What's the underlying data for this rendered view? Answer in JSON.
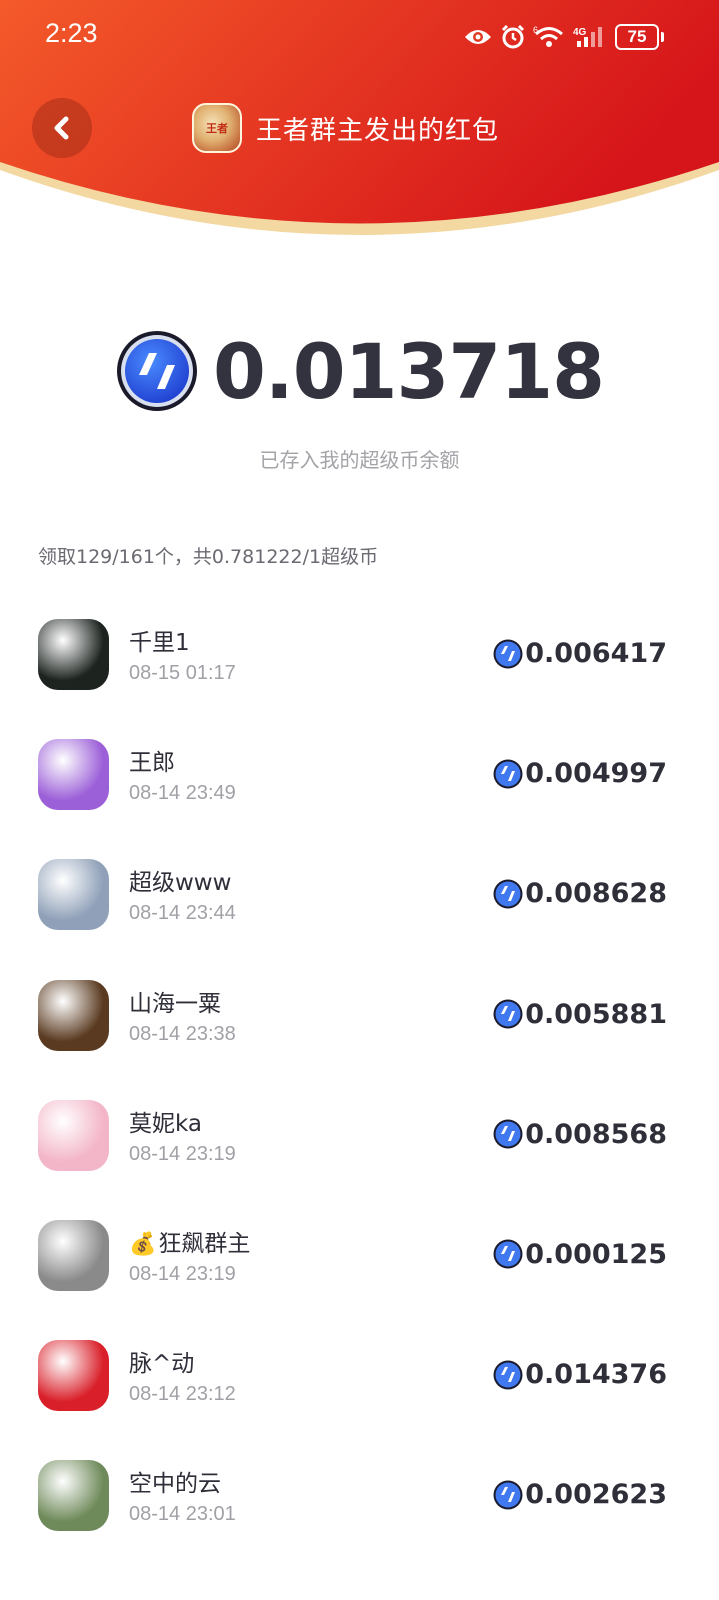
{
  "status_bar": {
    "time": "2:23",
    "network": "4G",
    "wifi_badge": "6",
    "battery": "75"
  },
  "header": {
    "title": "王者群主发出的红包",
    "back_icon": "chevron-left-icon",
    "avatar_text": "王者",
    "colors": {
      "top": "#f45a2a",
      "bottom": "#d6151a",
      "rim": "#f3d8a2"
    }
  },
  "received": {
    "amount": "0.013718",
    "subtitle": "已存入我的超级币余额"
  },
  "summary": "领取129/161个，共0.781222/1超级币",
  "claims": [
    {
      "name": "千里1",
      "time": "08-15 01:17",
      "amount": "0.006417",
      "avatar_color": "#1d2420"
    },
    {
      "name": "王郎",
      "time": "08-14 23:49",
      "amount": "0.004997",
      "avatar_color": "#9b5fd8"
    },
    {
      "name": "超级www",
      "time": "08-14 23:44",
      "amount": "0.008628",
      "avatar_color": "#8fa0b8"
    },
    {
      "name": "山海一粟",
      "time": "08-14 23:38",
      "amount": "0.005881",
      "avatar_color": "#5a3a20"
    },
    {
      "name": "莫妮ka",
      "time": "08-14 23:19",
      "amount": "0.008568",
      "avatar_color": "#f3b6c8"
    },
    {
      "name": "狂飙群主",
      "time": "08-14 23:19",
      "amount": "0.000125",
      "avatar_color": "#8a8a8a",
      "prefix_icon": "money-bag-icon"
    },
    {
      "name": "脉^动",
      "time": "08-14 23:12",
      "amount": "0.014376",
      "avatar_color": "#d9202a"
    },
    {
      "name": "空中的云",
      "time": "08-14 23:01",
      "amount": "0.002623",
      "avatar_color": "#6f8a5a"
    }
  ]
}
